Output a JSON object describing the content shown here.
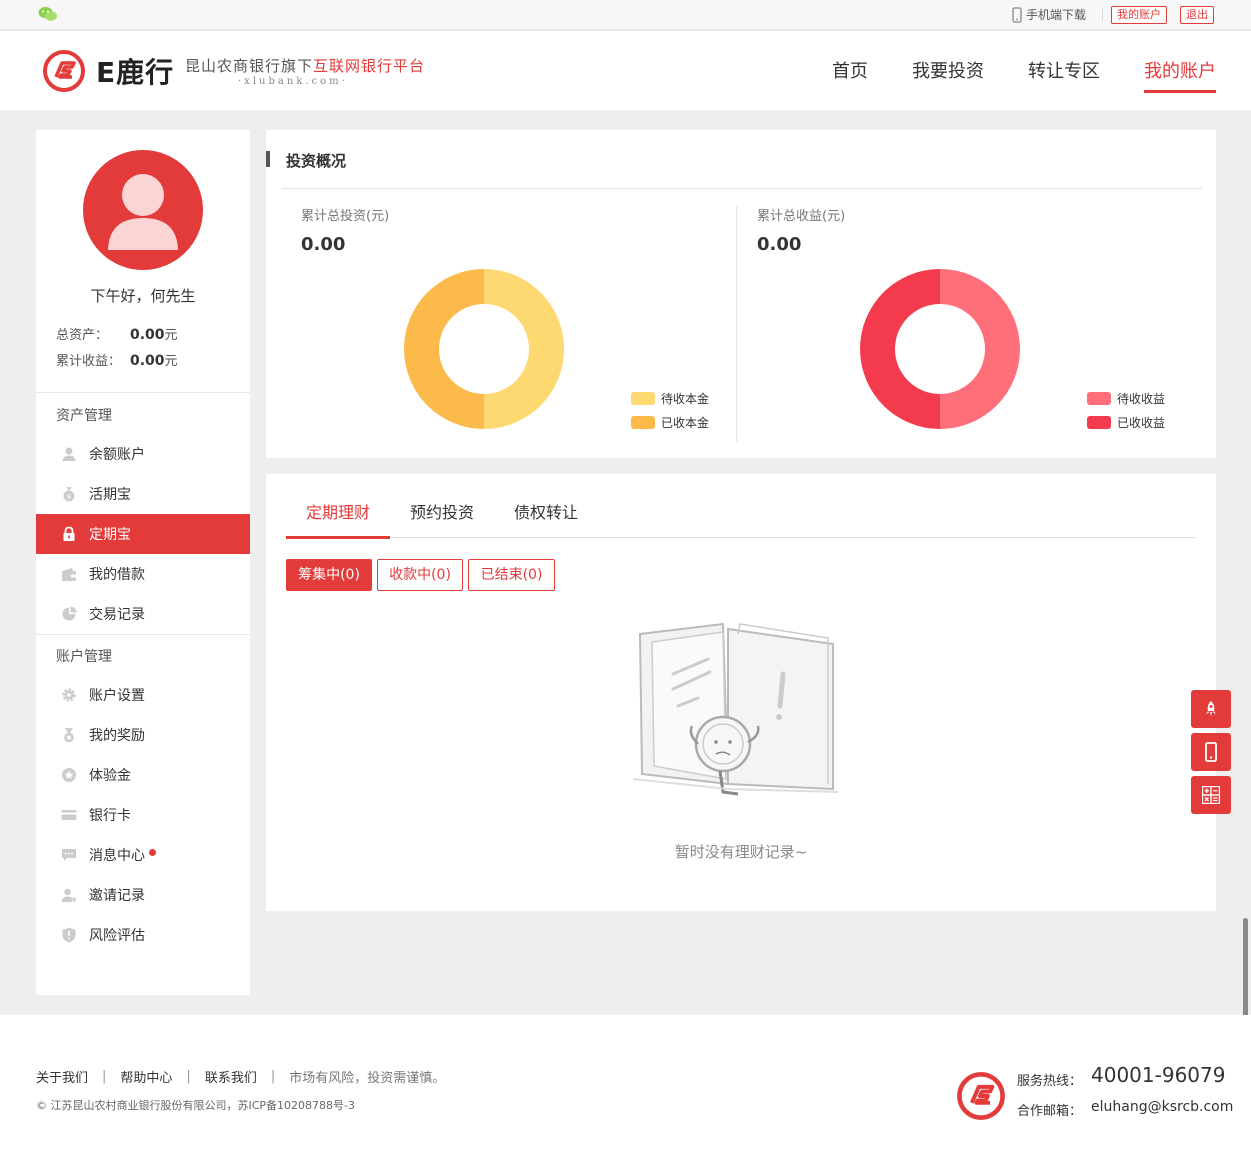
{
  "topbar": {
    "mobile_download": "手机端下载",
    "my_account": "我的账户",
    "logout": "退出"
  },
  "header": {
    "brand": "E鹿行",
    "slogan_part1": "昆山农商银行旗下",
    "slogan_part2": "互联网银行平台",
    "slogan_url": "·xlubank.com·",
    "nav": [
      "首页",
      "我要投资",
      "转让专区",
      "我的账户"
    ],
    "active_nav": "我的账户"
  },
  "sidebar": {
    "greeting": "下午好，何先生",
    "total_assets_label": "总资产：",
    "total_assets_value": "0.00",
    "total_assets_unit": "元",
    "total_income_label": "累计收益：",
    "total_income_value": "0.00",
    "total_income_unit": "元",
    "section1": "资产管理",
    "section1_items": [
      "余额账户",
      "活期宝",
      "定期宝",
      "我的借款",
      "交易记录"
    ],
    "section2": "账户管理",
    "section2_items": [
      "账户设置",
      "我的奖励",
      "体验金",
      "银行卡",
      "消息中心",
      "邀请记录",
      "风险评估"
    ],
    "active_item": "定期宝"
  },
  "overview": {
    "title": "投资概况",
    "left_label": "累计总投资(元)",
    "left_value": "0.00",
    "right_label": "累计总收益(元)",
    "right_value": "0.00",
    "left_legend": [
      "待收本金",
      "已收本金"
    ],
    "right_legend": [
      "待收收益",
      "已收收益"
    ]
  },
  "chart_data": [
    {
      "type": "pie",
      "categories": [
        "待收本金",
        "已收本金"
      ],
      "values": [
        50,
        50
      ],
      "colors": [
        "#fed870",
        "#fbba4a"
      ]
    },
    {
      "type": "pie",
      "categories": [
        "待收收益",
        "已收收益"
      ],
      "values": [
        50,
        50
      ],
      "colors": [
        "#fe6f7a",
        "#f33b4d"
      ]
    }
  ],
  "list": {
    "tabs": [
      "定期理财",
      "预约投资",
      "债权转让"
    ],
    "active_tab": "定期理财",
    "filters": [
      "筹集中(0)",
      "收款中(0)",
      "已结束(0)"
    ],
    "active_filter": "筹集中(0)",
    "empty_text": "暂时没有理财记录~"
  },
  "footer": {
    "links": [
      "关于我们",
      "帮助中心",
      "联系我们"
    ],
    "warning": "市场有风险，投资需谨慎。",
    "copyright": "© 江苏昆山农村商业银行股份有限公司，苏ICP备10208788号-3",
    "hotline_label": "服务热线：",
    "hotline": "40001-96079",
    "email_label": "合作邮箱：",
    "email": "eluhang@ksrcb.com"
  },
  "colors": {
    "accent": "#e33a3a",
    "background": "#eeeeee"
  }
}
